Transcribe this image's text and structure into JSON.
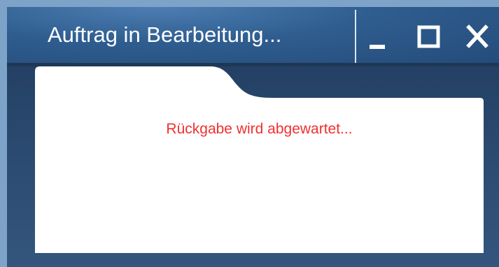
{
  "window": {
    "title": "Auftrag in Bearbeitung...",
    "controls": {
      "minimize_icon": "minimize-icon",
      "maximize_icon": "maximize-icon",
      "close_icon": "close-icon"
    }
  },
  "panel": {
    "status_text": "Rückgabe wird abgewartet..."
  },
  "colors": {
    "page_background": "#7ea3c8",
    "titlebar": "#2f5d8f",
    "window_body": "#2b4a70",
    "panel": "#ffffff",
    "status_text": "#f03030"
  }
}
